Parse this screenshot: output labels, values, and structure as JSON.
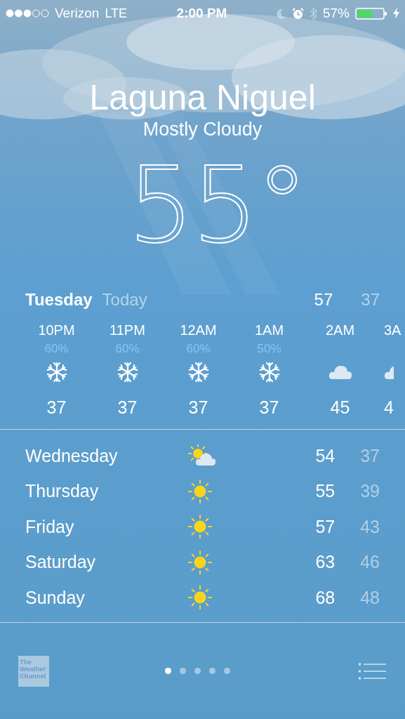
{
  "status_bar": {
    "carrier": "Verizon",
    "network": "LTE",
    "time": "2:00 PM",
    "battery": "57%"
  },
  "location": {
    "city": "Laguna Niguel",
    "condition": "Mostly Cloudy",
    "temperature": "55°"
  },
  "today": {
    "day": "Tuesday",
    "label": "Today",
    "high": "57",
    "low": "37"
  },
  "hourly": [
    {
      "kind": "snow",
      "time": "10PM",
      "chance": "60%",
      "temp": "37"
    },
    {
      "kind": "snow",
      "time": "11PM",
      "chance": "60%",
      "temp": "37"
    },
    {
      "kind": "snow",
      "time": "12AM",
      "chance": "60%",
      "temp": "37"
    },
    {
      "kind": "snow",
      "time": "1AM",
      "chance": "50%",
      "temp": "37"
    },
    {
      "kind": "cloud",
      "time": "2AM",
      "temp": "45"
    },
    {
      "kind": "cloud",
      "time": "3A",
      "temp": "4"
    }
  ],
  "daily": [
    {
      "day": "Wednesday",
      "kind": "partly-sunny",
      "high": "54",
      "low": "37"
    },
    {
      "day": "Thursday",
      "kind": "sunny",
      "high": "55",
      "low": "39"
    },
    {
      "day": "Friday",
      "kind": "sunny",
      "high": "57",
      "low": "43"
    },
    {
      "day": "Saturday",
      "kind": "sunny",
      "high": "63",
      "low": "46"
    },
    {
      "day": "Sunday",
      "kind": "sunny",
      "high": "68",
      "low": "48"
    }
  ],
  "footer": {
    "logo": [
      "The",
      "Weather",
      "Channel"
    ],
    "pages": [
      {
        "selected": true
      },
      {
        "selected": false
      },
      {
        "selected": false
      },
      {
        "selected": false
      },
      {
        "selected": false
      }
    ]
  }
}
